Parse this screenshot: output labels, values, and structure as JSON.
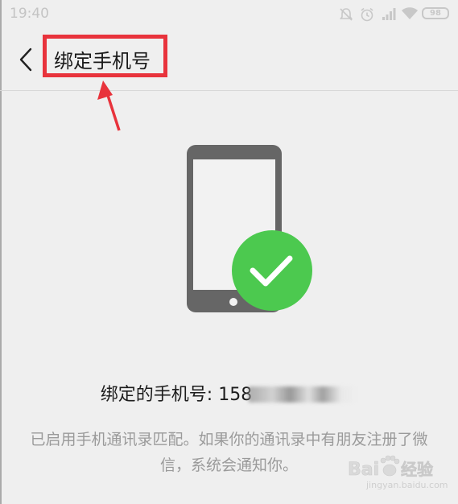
{
  "status_bar": {
    "time": "19:40",
    "battery": "98",
    "icons": [
      "mute-icon",
      "alarm-icon",
      "signal-icon",
      "wifi-icon",
      "battery-icon"
    ]
  },
  "header": {
    "title": "绑定手机号",
    "back_icon": "chevron-left-icon"
  },
  "annotation": {
    "color": "#e8333c",
    "icons": [
      "red-highlight-box",
      "red-arrow-icon"
    ]
  },
  "illustration": {
    "phone_color": "#666666",
    "check_color": "#4cc94f",
    "icons": [
      "phone-icon",
      "check-circle-icon"
    ]
  },
  "bound_number": {
    "label": "绑定的手机号: 158"
  },
  "description": "已启用手机通讯录匹配。如果你的通讯录中有朋友注册了微信，系统会通知你。",
  "watermark": {
    "brand": "Bai",
    "suffix": "经验",
    "url": "jingyan.baidu.com"
  }
}
